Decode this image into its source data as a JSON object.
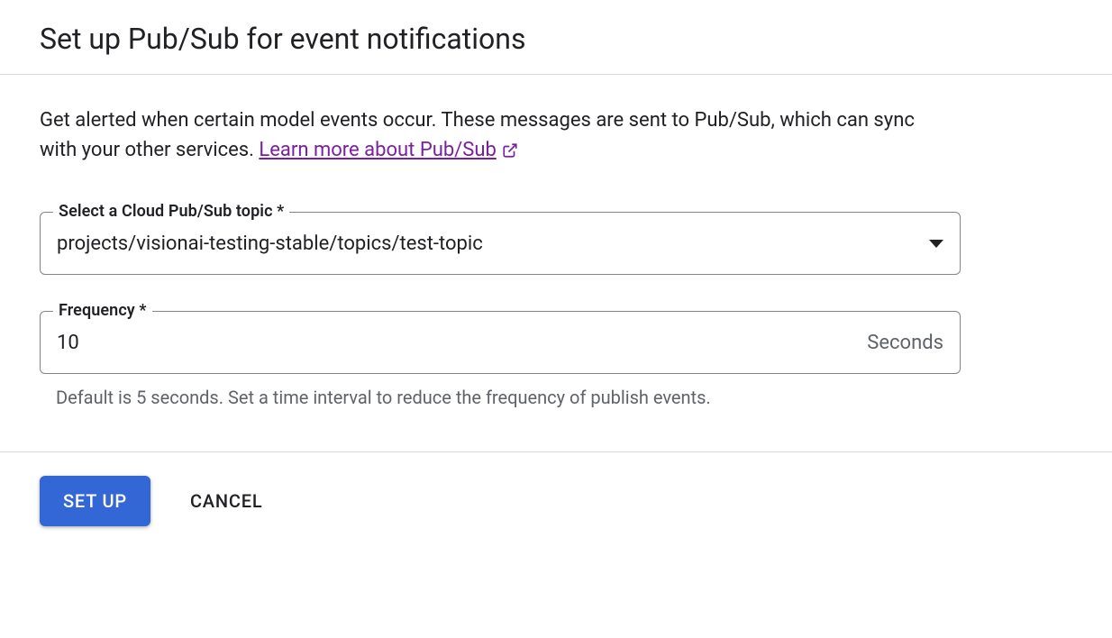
{
  "dialog": {
    "title": "Set up Pub/Sub for event notifications",
    "description_prefix": "Get alerted when certain model events occur. These messages are sent to Pub/Sub, which can sync with your other services. ",
    "learn_more": "Learn more about Pub/Sub"
  },
  "fields": {
    "topic": {
      "label": "Select a Cloud Pub/Sub topic *",
      "value": "projects/visionai-testing-stable/topics/test-topic"
    },
    "frequency": {
      "label": "Frequency *",
      "value": "10",
      "suffix": "Seconds",
      "helper": "Default is 5 seconds. Set a time interval to reduce the frequency of publish events."
    }
  },
  "actions": {
    "primary": "Set up",
    "cancel": "Cancel"
  }
}
